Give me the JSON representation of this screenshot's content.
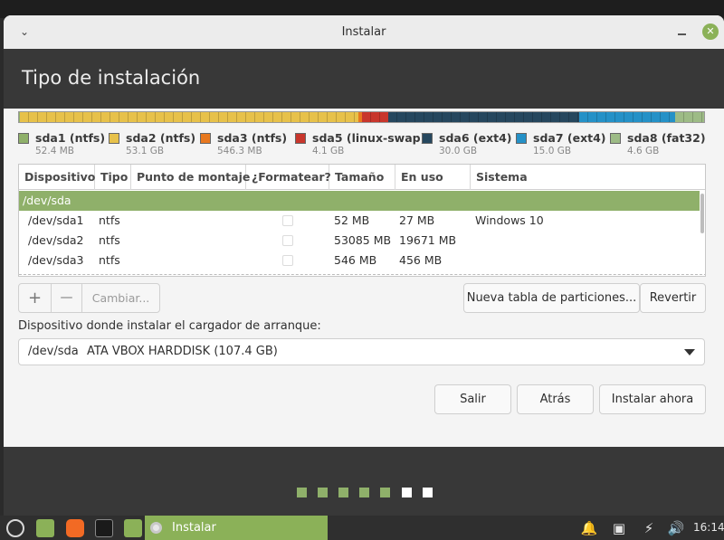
{
  "window": {
    "title": "Instalar",
    "heading": "Tipo de instalación"
  },
  "partitions": [
    {
      "name": "sda1 (ntfs)",
      "size": "52.4 MB",
      "color": "#8fb06a"
    },
    {
      "name": "sda2 (ntfs)",
      "size": "53.1 GB",
      "color": "#e7c14a"
    },
    {
      "name": "sda3 (ntfs)",
      "size": "546.3 MB",
      "color": "#e8781f"
    },
    {
      "name": "sda5 (linux-swap)",
      "size": "4.1 GB",
      "color": "#c8362c"
    },
    {
      "name": "sda6 (ext4)",
      "size": "30.0 GB",
      "color": "#26475e"
    },
    {
      "name": "sda7 (ext4)",
      "size": "15.0 GB",
      "color": "#2591c7"
    },
    {
      "name": "sda8 (fat32)",
      "size": "4.6 GB",
      "color": "#9dbb86"
    }
  ],
  "table": {
    "columns": [
      "Dispositivo",
      "Tipo",
      "Punto de montaje",
      "¿Formatear?",
      "Tamaño",
      "En uso",
      "Sistema"
    ],
    "group": "/dev/sda",
    "rows": [
      {
        "device": "/dev/sda1",
        "type": "ntfs",
        "mount": "",
        "size": "52 MB",
        "used": "27 MB",
        "system": "Windows 10"
      },
      {
        "device": "/dev/sda2",
        "type": "ntfs",
        "mount": "",
        "size": "53085 MB",
        "used": "19671 MB",
        "system": ""
      },
      {
        "device": "/dev/sda3",
        "type": "ntfs",
        "mount": "",
        "size": "546 MB",
        "used": "456 MB",
        "system": ""
      }
    ]
  },
  "toolbar": {
    "add": "+",
    "remove": "—",
    "change": "Cambiar...",
    "new_table": "Nueva tabla de particiones...",
    "revert": "Revertir"
  },
  "bootloader": {
    "label": "Dispositivo donde instalar el cargador de arranque:",
    "device": "/dev/sda",
    "description": "ATA VBOX HARDDISK (107.4 GB)"
  },
  "buttons": {
    "quit": "Salir",
    "back": "Atrás",
    "install": "Instalar ahora"
  },
  "progress": {
    "total_steps": 7,
    "completed_steps": 5,
    "done_color": "#8fb06a",
    "todo_color": "#ffffff"
  },
  "taskbar": {
    "task_label": "Instalar",
    "clock": "16:14"
  }
}
